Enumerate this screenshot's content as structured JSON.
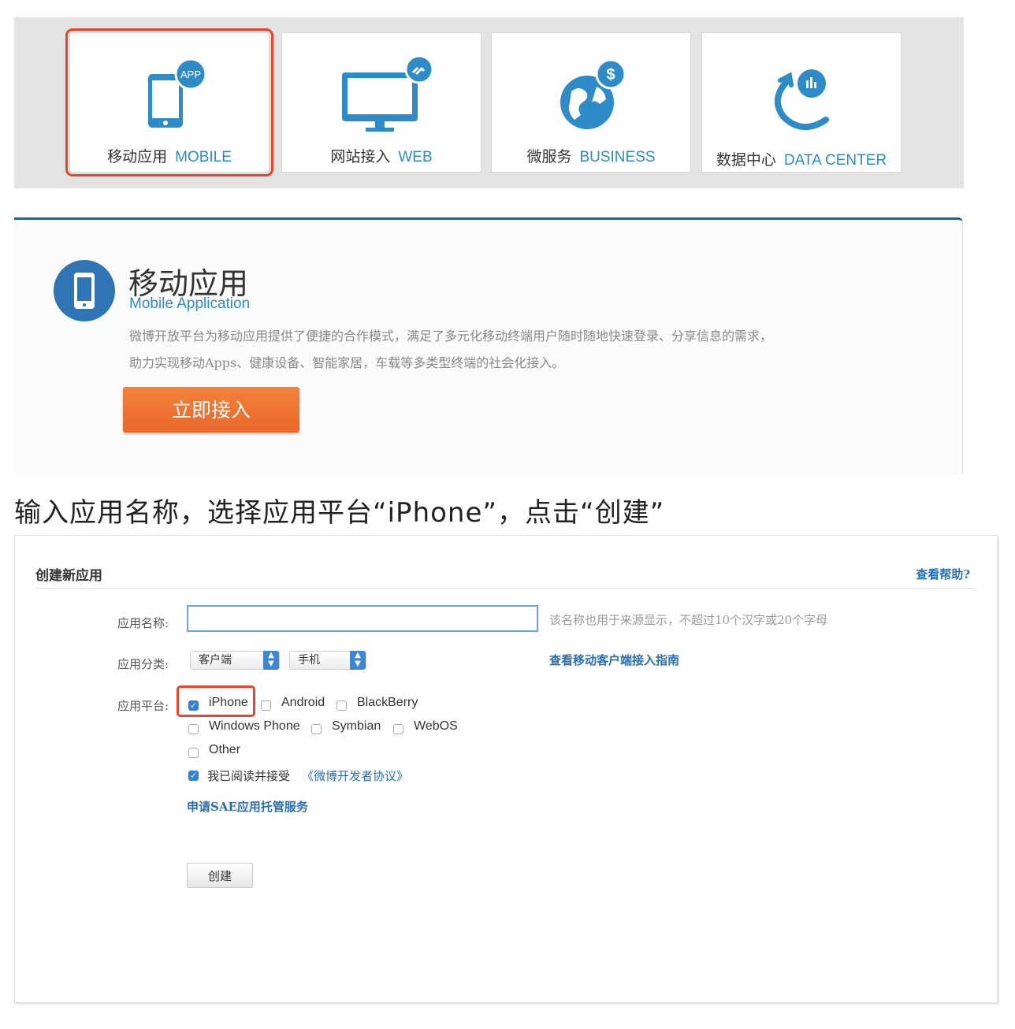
{
  "categories": [
    {
      "zh": "移动应用",
      "en": "MOBILE",
      "icon": "mobile-app-icon",
      "selected": true
    },
    {
      "zh": "网站接入",
      "en": "WEB",
      "icon": "web-monitor-icon",
      "selected": false
    },
    {
      "zh": "微服务",
      "en": "BUSINESS",
      "icon": "globe-dollar-icon",
      "selected": false
    },
    {
      "zh": "数据中心",
      "en": "DATA CENTER",
      "icon": "data-center-icon",
      "selected": false
    }
  ],
  "app_badge": "APP",
  "mobile_panel": {
    "title": "移动应用",
    "subtitle": "Mobile Application",
    "desc_line1": "微博开放平台为移动应用提供了便捷的合作模式，满足了多元化移动终端用户随时随地快速登录、分享信息的需求，",
    "desc_line2": "助力实现移动Apps、健康设备、智能家居，车载等多类型终端的社会化接入。",
    "button_label": "立即接入"
  },
  "instruction": "输入应用名称，选择应用平台“iPhone”，点击“创建”",
  "form": {
    "title": "创建新应用",
    "help_link": "查看帮助?",
    "name_label": "应用名称:",
    "name_value": "",
    "name_hint": "该名称也用于来源显示，不超过10个汉字或20个字母",
    "category_label": "应用分类:",
    "category_value": "客户端",
    "device_value": "手机",
    "guide_link": "查看移动客户端接入指南",
    "platform_label": "应用平台:",
    "platforms": [
      {
        "label": "iPhone",
        "checked": true
      },
      {
        "label": "Android",
        "checked": false
      },
      {
        "label": "BlackBerry",
        "checked": false
      },
      {
        "label": "Windows Phone",
        "checked": false
      },
      {
        "label": "Symbian",
        "checked": false
      },
      {
        "label": "WebOS",
        "checked": false
      },
      {
        "label": "Other",
        "checked": false
      }
    ],
    "agree_text": "我已阅读并接受",
    "agree_link": "《微博开发者协议》",
    "agree_checked": true,
    "sae_link": "申请SAE应用托管服务",
    "create_label": "创建"
  },
  "colors": {
    "accent_blue": "#2d8cc8",
    "highlight_red": "#e8452c",
    "button_orange": "#ed6f2e",
    "link_blue": "#2a6fb0"
  }
}
